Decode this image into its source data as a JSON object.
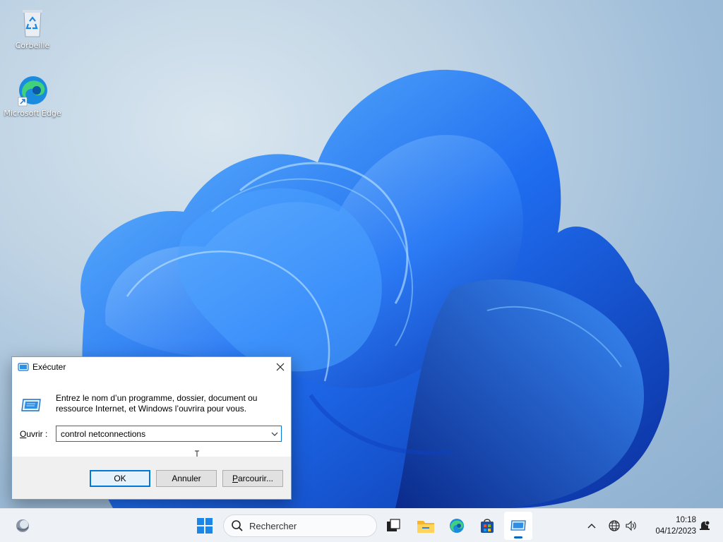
{
  "desktop": {
    "icons": [
      {
        "label": "Corbeille",
        "icon": "recycle-bin-icon"
      },
      {
        "label": "Microsoft Edge",
        "icon": "edge-icon"
      }
    ]
  },
  "run_dialog": {
    "title": "Exécuter",
    "description": "Entrez le nom d’un programme, dossier, document ou ressource Internet, et Windows l’ouvrira pour vous.",
    "open_label_prefix": "O",
    "open_label_rest": "uvrir :",
    "input_value": "control netconnections",
    "ok_label": "OK",
    "cancel_label": "Annuler",
    "browse_label_prefix": "P",
    "browse_label_rest": "arcourir..."
  },
  "taskbar": {
    "search_placeholder": "Rechercher",
    "apps": [
      "start-icon",
      "search-icon",
      "task-view-icon",
      "file-explorer-icon",
      "edge-icon",
      "store-icon",
      "run-icon"
    ],
    "accent_color": "#0067c0"
  },
  "tray": {
    "time": "10:18",
    "date": "04/12/2023"
  }
}
